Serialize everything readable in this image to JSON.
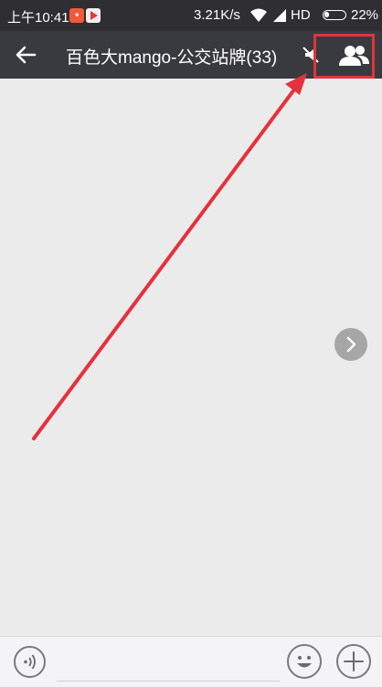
{
  "status_bar": {
    "time": "上午10:41",
    "network_speed": "3.21K/s",
    "network_type": "HD",
    "battery_percent": "22%",
    "battery_level": 0.22,
    "notification_icons": [
      "app-notification-icon",
      "video-app-icon"
    ]
  },
  "header": {
    "title": "百色大mango-公交站牌(33)",
    "back_icon": "arrow-left-icon",
    "muted_icon": "mute-icon",
    "members_icon": "group-members-icon",
    "members_highlight_color": "#e4323c"
  },
  "chat": {
    "next_icon": "chevron-right-icon"
  },
  "input_bar": {
    "voice_icon": "voice-icon",
    "message_placeholder": "",
    "emoji_icon": "emoji-icon",
    "plus_icon": "plus-icon"
  },
  "colors": {
    "status_bar_bg": "#2e2e33",
    "header_bg": "#393a3f",
    "chat_bg": "#ebebeb",
    "annotation": "#e4323c"
  }
}
